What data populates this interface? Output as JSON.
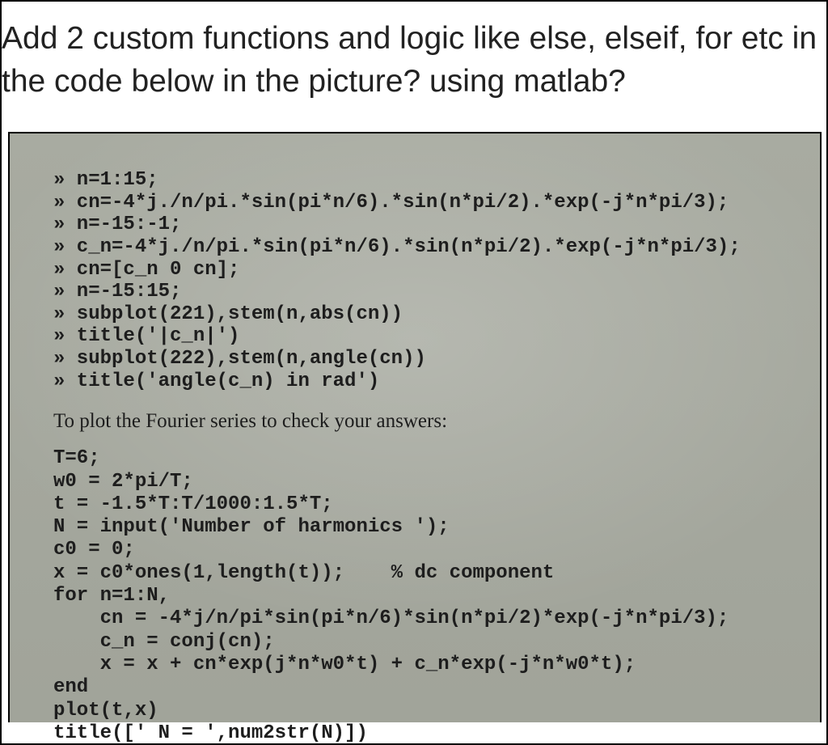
{
  "question": "Add 2 custom functions and logic like else, elseif, for etc in the code below in the picture? using matlab?",
  "code1": "» n=1:15;\n» cn=-4*j./n/pi.*sin(pi*n/6).*sin(n*pi/2).*exp(-j*n*pi/3);\n» n=-15:-1;\n» c_n=-4*j./n/pi.*sin(pi*n/6).*sin(n*pi/2).*exp(-j*n*pi/3);\n» cn=[c_n 0 cn];\n» n=-15:15;\n» subplot(221),stem(n,abs(cn))\n» title('|c_n|')\n» subplot(222),stem(n,angle(cn))\n» title('angle(c_n) in rad')",
  "caption": "To plot the Fourier series to check your answers:",
  "code2": "T=6;\nw0 = 2*pi/T;\nt = -1.5*T:T/1000:1.5*T;\nN = input('Number of harmonics ');\nc0 = 0;\nx = c0*ones(1,length(t));    % dc component\nfor n=1:N,\n    cn = -4*j/n/pi*sin(pi*n/6)*sin(n*pi/2)*exp(-j*n*pi/3);\n    c_n = conj(cn);\n    x = x + cn*exp(j*n*w0*t) + c_n*exp(-j*n*w0*t);\nend\nplot(t,x)\ntitle([' N = ',num2str(N)])"
}
